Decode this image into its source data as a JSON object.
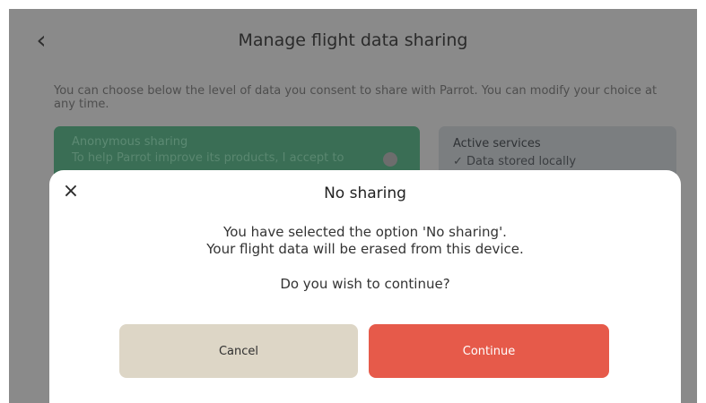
{
  "header": {
    "back_icon": "chevron-left-icon",
    "back_glyph": "‹",
    "title": "Manage flight data sharing"
  },
  "intro": "You can choose below the level of data you consent to share with Parrot. You can modify your choice at any time.",
  "option_card": {
    "title": "Anonymous sharing",
    "description": "To help Parrot improve its products, I accept to",
    "color": "#3a6e55"
  },
  "services_card": {
    "title": "Active services",
    "item": "✓  Data stored locally"
  },
  "modal": {
    "close_icon": "close-icon",
    "close_glyph": "×",
    "title": "No sharing",
    "line1": "You have selected the option 'No sharing'.",
    "line2": "Your flight data will be erased from this device.",
    "question": "Do you wish to continue?",
    "cancel_label": "Cancel",
    "continue_label": "Continue"
  },
  "colors": {
    "cancel_button": "#ddd6c6",
    "continue_button": "#e65a4a"
  }
}
